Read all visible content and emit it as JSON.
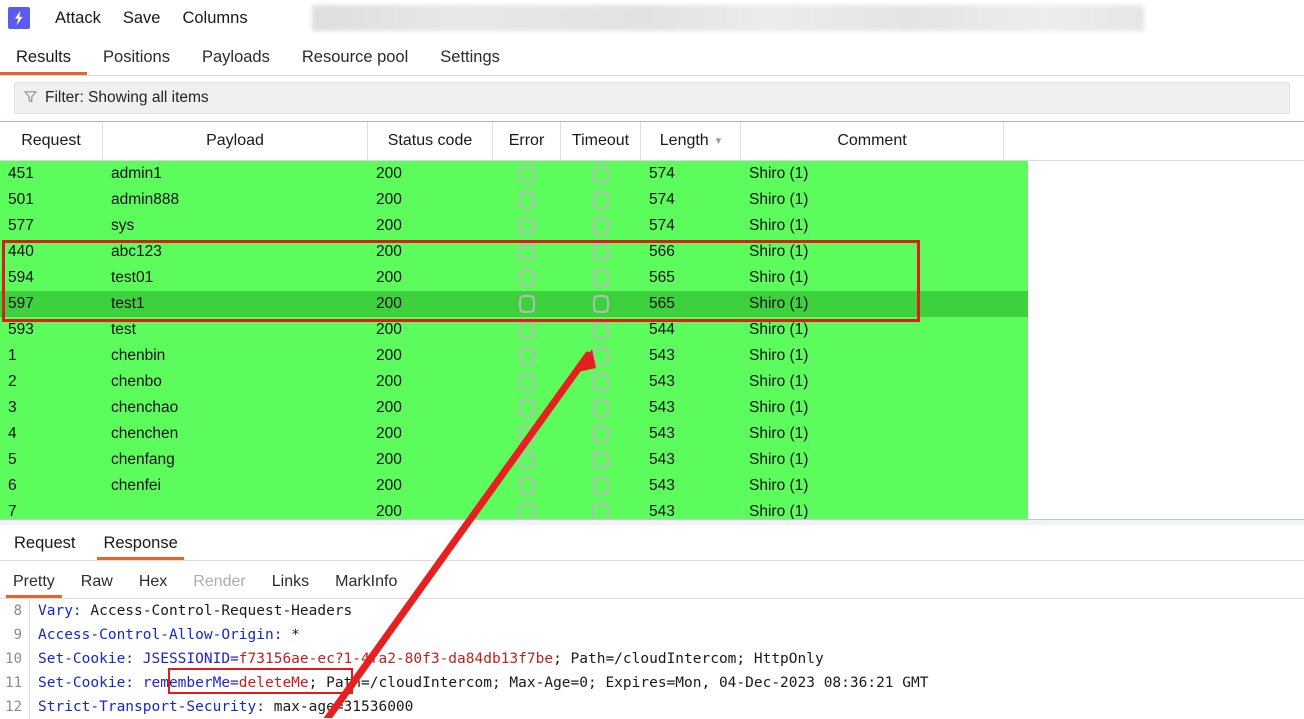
{
  "topbar": {
    "logo_icon": "burp-lightning-icon",
    "menu": [
      {
        "label": "Attack"
      },
      {
        "label": "Save"
      },
      {
        "label": "Columns"
      }
    ],
    "redacted_region": true
  },
  "main_tabs": [
    {
      "label": "Results",
      "active": true
    },
    {
      "label": "Positions",
      "active": false
    },
    {
      "label": "Payloads",
      "active": false
    },
    {
      "label": "Resource pool",
      "active": false
    },
    {
      "label": "Settings",
      "active": false
    }
  ],
  "filter": {
    "icon": "funnel-filter-icon",
    "label": "Filter: Showing all items"
  },
  "results_table": {
    "columns": [
      {
        "key": "request",
        "label": "Request"
      },
      {
        "key": "payload",
        "label": "Payload"
      },
      {
        "key": "status",
        "label": "Status code"
      },
      {
        "key": "error",
        "label": "Error"
      },
      {
        "key": "timeout",
        "label": "Timeout"
      },
      {
        "key": "length",
        "label": "Length",
        "sorted": true,
        "sort_glyph": "chevron-down-icon"
      },
      {
        "key": "comment",
        "label": "Comment"
      }
    ],
    "rows": [
      {
        "request": "451",
        "payload": "admin1",
        "status": "200",
        "error": false,
        "timeout": false,
        "length": "574",
        "comment": "Shiro (1)",
        "selected": false,
        "highlighted": false
      },
      {
        "request": "501",
        "payload": "admin888",
        "status": "200",
        "error": false,
        "timeout": false,
        "length": "574",
        "comment": "Shiro (1)",
        "selected": false,
        "highlighted": false
      },
      {
        "request": "577",
        "payload": "sys",
        "status": "200",
        "error": false,
        "timeout": false,
        "length": "574",
        "comment": "Shiro (1)",
        "selected": false,
        "highlighted": false
      },
      {
        "request": "440",
        "payload": "abc123",
        "status": "200",
        "error": false,
        "timeout": false,
        "length": "566",
        "comment": "Shiro (1)",
        "selected": false,
        "highlighted": true
      },
      {
        "request": "594",
        "payload": "test01",
        "status": "200",
        "error": false,
        "timeout": false,
        "length": "565",
        "comment": "Shiro (1)",
        "selected": false,
        "highlighted": true
      },
      {
        "request": "597",
        "payload": "test1",
        "status": "200",
        "error": false,
        "timeout": false,
        "length": "565",
        "comment": "Shiro (1)",
        "selected": true,
        "highlighted": true
      },
      {
        "request": "593",
        "payload": "test",
        "status": "200",
        "error": false,
        "timeout": false,
        "length": "544",
        "comment": "Shiro (1)",
        "selected": false,
        "highlighted": false
      },
      {
        "request": "1",
        "payload": "chenbin",
        "status": "200",
        "error": false,
        "timeout": false,
        "length": "543",
        "comment": "Shiro (1)",
        "selected": false,
        "highlighted": false
      },
      {
        "request": "2",
        "payload": "chenbo",
        "status": "200",
        "error": false,
        "timeout": false,
        "length": "543",
        "comment": "Shiro (1)",
        "selected": false,
        "highlighted": false
      },
      {
        "request": "3",
        "payload": "chenchao",
        "status": "200",
        "error": false,
        "timeout": false,
        "length": "543",
        "comment": "Shiro (1)",
        "selected": false,
        "highlighted": false
      },
      {
        "request": "4",
        "payload": "chenchen",
        "status": "200",
        "error": false,
        "timeout": false,
        "length": "543",
        "comment": "Shiro (1)",
        "selected": false,
        "highlighted": false
      },
      {
        "request": "5",
        "payload": "chenfang",
        "status": "200",
        "error": false,
        "timeout": false,
        "length": "543",
        "comment": "Shiro (1)",
        "selected": false,
        "highlighted": false
      },
      {
        "request": "6",
        "payload": "chenfei",
        "status": "200",
        "error": false,
        "timeout": false,
        "length": "543",
        "comment": "Shiro (1)",
        "selected": false,
        "highlighted": false
      },
      {
        "request": "7",
        "payload": "",
        "status": "200",
        "error": false,
        "timeout": false,
        "length": "543",
        "comment": "Shiro (1)",
        "selected": false,
        "highlighted": false
      }
    ]
  },
  "message_tabs": [
    {
      "label": "Request",
      "active": false
    },
    {
      "label": "Response",
      "active": true
    }
  ],
  "view_tabs": [
    {
      "label": "Pretty",
      "active": true,
      "disabled": false
    },
    {
      "label": "Raw",
      "active": false,
      "disabled": false
    },
    {
      "label": "Hex",
      "active": false,
      "disabled": false
    },
    {
      "label": "Render",
      "active": false,
      "disabled": true
    },
    {
      "label": "Links",
      "active": false,
      "disabled": false
    },
    {
      "label": "MarkInfo",
      "active": false,
      "disabled": false
    }
  ],
  "response_lines": [
    {
      "num": "8",
      "header": "Vary",
      "value": " Access-Control-Request-Headers"
    },
    {
      "num": "9",
      "header": "Access-Control-Allow-Origin",
      "value": " *"
    },
    {
      "num": "10",
      "header": "Set-Cookie",
      "cookie_key": " JSESSIONID",
      "cookie_value": "f73156ae-ec?1-4fa2-80f3-da84db13f7be",
      "value": "; Path=/cloudIntercom; HttpOnly"
    },
    {
      "num": "11",
      "header": "Set-Cookie",
      "cookie_key": " rememberMe",
      "cookie_value": "deleteMe",
      "value": "; Path=/cloudIntercom; Max-Age=0; Expires=Mon, 04-Dec-2023 08:36:21 GMT"
    },
    {
      "num": "12",
      "header": "Strict-Transport-Security",
      "value": " max-age=31536000"
    }
  ],
  "annotations": {
    "row_highlight_box_color": "#e01b1b",
    "cookie_highlight_box_color": "#e01b1b",
    "arrow_color": "#e81f1f",
    "arrow_from": "325,718",
    "arrow_to": "592,350"
  },
  "colors": {
    "row_green": "#5cfc5c",
    "row_green_selected": "#3ed13e",
    "accent_orange": "#e8622c",
    "logo_indigo": "#5b5bf0"
  }
}
